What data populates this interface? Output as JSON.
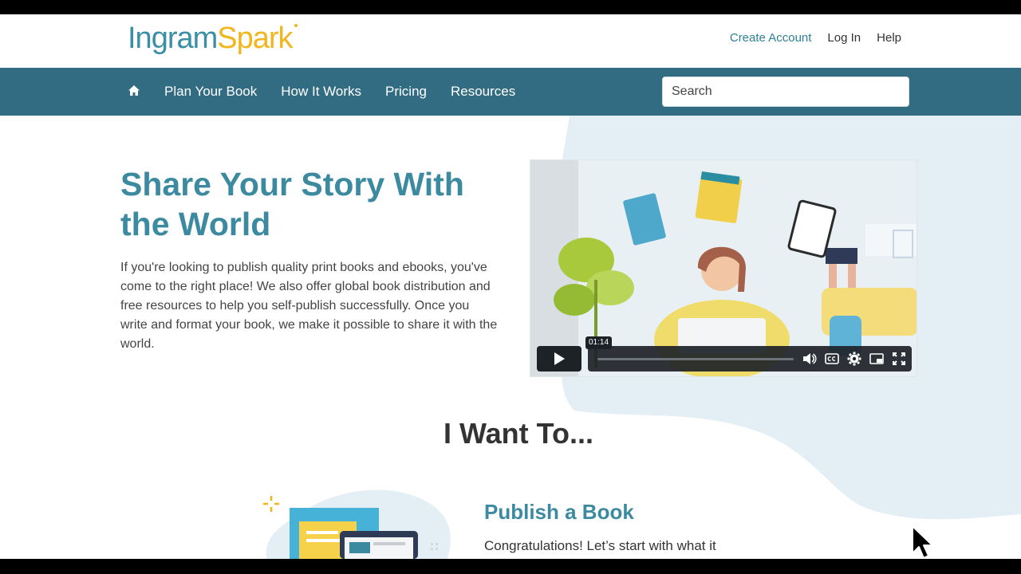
{
  "header": {
    "logo": {
      "part1": "Ingram",
      "part2": "Spark"
    },
    "links": {
      "create_account": "Create Account",
      "log_in": "Log In",
      "help": "Help"
    }
  },
  "nav": {
    "items": [
      "Plan Your Book",
      "How It Works",
      "Pricing",
      "Resources"
    ],
    "search_placeholder": "Search"
  },
  "hero": {
    "title": "Share Your Story With the World",
    "body": "If you're looking to publish quality print books and ebooks, you've come to the right place! We also offer global book distribution and free resources to help you self-publish successfully. Once you write and format your book, we make it possible to share it with the world."
  },
  "video": {
    "time_tooltip": "01:14",
    "progress": 0.0
  },
  "section": {
    "title": "I Want To..."
  },
  "publish": {
    "title": "Publish a Book",
    "text": "Congratulations! Let’s start with what it"
  },
  "colors": {
    "brand_teal": "#3b8aa0",
    "nav_bg": "#316c82",
    "brand_yellow": "#f2b51c",
    "blob": "#e4eef5"
  }
}
